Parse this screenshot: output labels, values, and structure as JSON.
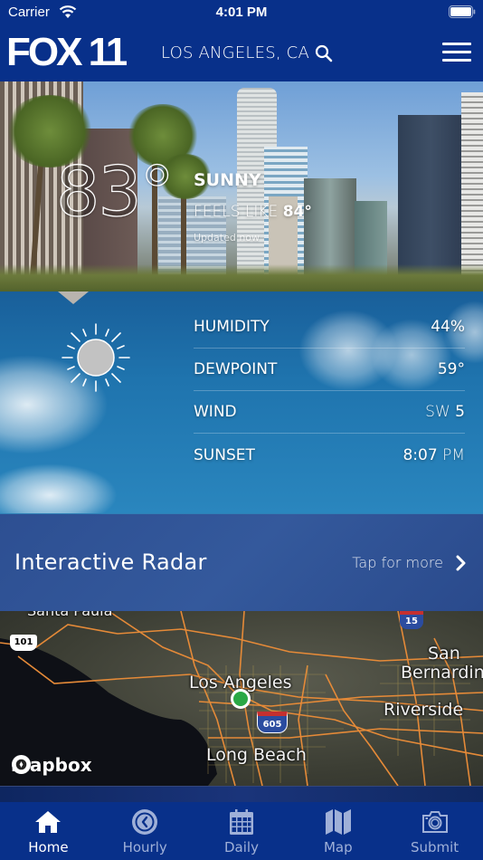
{
  "status_bar": {
    "carrier": "Carrier",
    "time": "4:01 PM",
    "icons": [
      "wifi-icon",
      "battery-icon"
    ]
  },
  "header": {
    "logo": "FOX 11",
    "location": "LOS ANGELES, CA",
    "icons": [
      "search-icon",
      "hamburger-menu-icon"
    ]
  },
  "current": {
    "temperature": "83°",
    "condition": "SUNNY",
    "feels_like_label": "FEELS LIKE",
    "feels_like_value": "84°",
    "updated": "Updated now",
    "condition_icon": "sun-icon"
  },
  "stats": [
    {
      "label": "HUMIDITY",
      "value": "44%",
      "unit": ""
    },
    {
      "label": "DEWPOINT",
      "value": "59°",
      "unit": ""
    },
    {
      "label": "WIND",
      "value": "5",
      "unit": "SW"
    },
    {
      "label": "SUNSET",
      "value": "8:07",
      "unit": "PM"
    }
  ],
  "radar": {
    "title": "Interactive Radar",
    "more_label": "Tap for more"
  },
  "map": {
    "labels": [
      "Santa Paula",
      "Los Angeles",
      "Long Beach",
      "San",
      "Bernardino",
      "Riverside"
    ],
    "shields": [
      "101",
      "15",
      "605"
    ],
    "attribution": "mapbox",
    "marker_color": "#2aa845"
  },
  "tabbar": {
    "tabs": [
      {
        "label": "Home",
        "icon": "home-icon",
        "active": true
      },
      {
        "label": "Hourly",
        "icon": "clock-icon",
        "active": false
      },
      {
        "label": "Daily",
        "icon": "calendar-icon",
        "active": false
      },
      {
        "label": "Map",
        "icon": "map-icon",
        "active": false
      },
      {
        "label": "Submit",
        "icon": "camera-icon",
        "active": false
      }
    ]
  },
  "colors": {
    "brand_blue": "#08308a",
    "tab_inactive": "#9fb0d8",
    "panel_blue": "#1f74ae"
  }
}
